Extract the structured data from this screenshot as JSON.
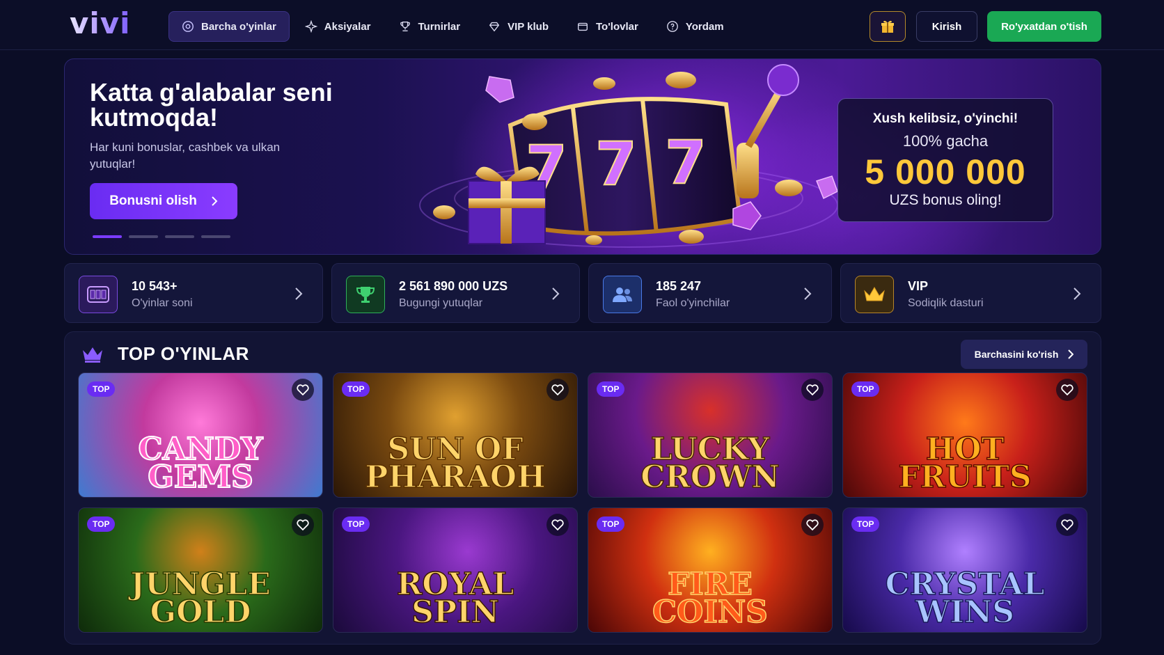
{
  "header": {
    "logo": "vivi",
    "nav": [
      {
        "label": "Barcha o'yinlar",
        "icon": "games-icon",
        "active": true
      },
      {
        "label": "Aksiyalar",
        "icon": "sparkle-icon",
        "active": false
      },
      {
        "label": "Turnirlar",
        "icon": "trophy-icon",
        "active": false
      },
      {
        "label": "VIP klub",
        "icon": "diamond-icon",
        "active": false
      },
      {
        "label": "To'lovlar",
        "icon": "wallet-icon",
        "active": false
      },
      {
        "label": "Yordam",
        "icon": "help-icon",
        "active": false
      }
    ],
    "gift_icon": "gift-icon",
    "login_label": "Kirish",
    "register_label": "Ro'yxatdan o'tish"
  },
  "hero": {
    "title": "Katta g'alabalar seni kutmoqda!",
    "subtitle": "Har kuni bonuslar, cashbek va ulkan yutuqlar!",
    "cta_label": "Bonusni olish",
    "slides": 4,
    "active_slide": 1,
    "promo": {
      "welcome": "Xush kelibsiz, o'yinchi!",
      "upto": "100% gacha",
      "amount": "5 000 000",
      "tail": "UZS bonus oling!"
    }
  },
  "stats": [
    {
      "value": "10 543+",
      "label": "O'yinlar soni",
      "icon": "slot-machine-icon"
    },
    {
      "value": "2 561 890 000 UZS",
      "label": "Bugungi yutuqlar",
      "icon": "trophy-icon"
    },
    {
      "value": "185 247",
      "label": "Faol o'yinchilar",
      "icon": "users-icon"
    },
    {
      "value": "VIP",
      "label": "Sodiqlik dasturi",
      "icon": "crown-icon"
    }
  ],
  "games_section": {
    "title": "TOP O'YINLAR",
    "see_all_label": "Barchasini ko'rish",
    "badge_label": "TOP",
    "games": [
      {
        "name": "Candy\nGems"
      },
      {
        "name": "Sun of\nPharaoh"
      },
      {
        "name": "Lucky\nCrown"
      },
      {
        "name": "Hot\nFruits"
      },
      {
        "name": "Jungle\nGold"
      },
      {
        "name": "Royal\nSpin"
      },
      {
        "name": "Fire\nCoins"
      },
      {
        "name": "Crystal\nWins"
      }
    ]
  },
  "colors": {
    "background": "#0b0d26",
    "accent_purple": "#6a2cf2",
    "register_green": "#1aa854",
    "promo_gold": "#ffc83a"
  }
}
